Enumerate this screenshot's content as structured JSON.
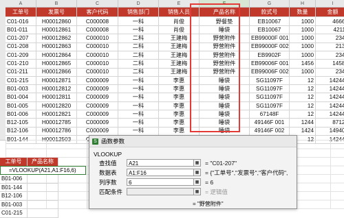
{
  "columns": [
    "A",
    "B",
    "C",
    "D",
    "E",
    "F",
    "G",
    "H",
    "I"
  ],
  "header": [
    "工单号",
    "发票号",
    "客户代码",
    "销售部门",
    "销售人员",
    "产品名称",
    "款式号",
    "数量",
    "金额"
  ],
  "rows": [
    [
      "C01-016",
      "H00012860",
      "C000008",
      "一科",
      "肖俊",
      "野餐垫",
      "EB10067",
      "1000",
      "46661"
    ],
    [
      "B01-011",
      "H00012861",
      "C000008",
      "一科",
      "肖俊",
      "睡袋",
      "EB10067",
      "1000",
      "42111"
    ],
    [
      "C01-207",
      "H00012862",
      "C000010",
      "二科",
      "王建梅",
      "野营附件",
      "EB99000F 001",
      "1000",
      "2340"
    ],
    [
      "C01-208",
      "H00012863",
      "C000010",
      "二科",
      "王建梅",
      "野营附件",
      "EB99000F 002",
      "1000",
      "2136"
    ],
    [
      "C01-209",
      "H00012864",
      "C000010",
      "二科",
      "王建梅",
      "野营附件",
      "EB9902F",
      "1000",
      "2340"
    ],
    [
      "C01-210",
      "H00012865",
      "C000010",
      "二科",
      "王建梅",
      "野营附件",
      "EB99006F 001",
      "1456",
      "14581"
    ],
    [
      "C01-211",
      "H00012866",
      "C000010",
      "二科",
      "王建梅",
      "野营附件",
      "EB99006F 002",
      "1000",
      "2340"
    ],
    [
      "C01-215",
      "H00012871",
      "C000009",
      "一科",
      "李惠",
      "睡袋",
      "SG11097F",
      "12",
      "142448"
    ],
    [
      "B01-003",
      "H00012812",
      "C000009",
      "一科",
      "李惠",
      "睡袋",
      "SG11097F",
      "12",
      "142448"
    ],
    [
      "B01-004",
      "H00012811",
      "C000009",
      "一科",
      "李惠",
      "睡袋",
      "SG11097F",
      "12",
      "142448"
    ],
    [
      "B01-005",
      "H00012820",
      "C000009",
      "一科",
      "李惠",
      "睡袋",
      "SG11097F",
      "12",
      "142448"
    ],
    [
      "B01-006",
      "H00012821",
      "C000009",
      "一科",
      "李惠",
      "睡袋",
      "67148F",
      "12",
      "142448"
    ],
    [
      "B12-105",
      "H00012785",
      "C000009",
      "一科",
      "李惠",
      "睡袋",
      "49146F 001",
      "1244",
      "87124"
    ],
    [
      "B12-106",
      "H00012786",
      "C000009",
      "一科",
      "李惠",
      "睡袋",
      "49146F 002",
      "1424",
      "149400"
    ],
    [
      "B01-144",
      "H00012503",
      "C000009",
      "一科",
      "李惠",
      "睡袋",
      "49146F 001",
      "12",
      "142448"
    ]
  ],
  "mini_table": {
    "header": [
      "工单号",
      "产品名称"
    ],
    "formula": "=VLOOKUP(A21,A1:F16,6)",
    "ids": [
      "B01-006",
      "B01-144",
      "B12-106",
      "B01-003",
      "C01-215"
    ]
  },
  "dialog": {
    "title": "函数参数",
    "function": "VLOOKUP",
    "args": [
      {
        "label": "查找值",
        "value": "A21",
        "eval": "= \"C01-207\""
      },
      {
        "label": "数据表",
        "value": "A1:F16",
        "eval": "= {\"工单号\",\"发票号\",\"客户代码\","
      },
      {
        "label": "列序数",
        "value": "6",
        "eval": "= 6"
      },
      {
        "label": "匹配条件",
        "value": "",
        "eval": "= 逻辑值"
      }
    ],
    "result": "= \"野营附件\""
  }
}
